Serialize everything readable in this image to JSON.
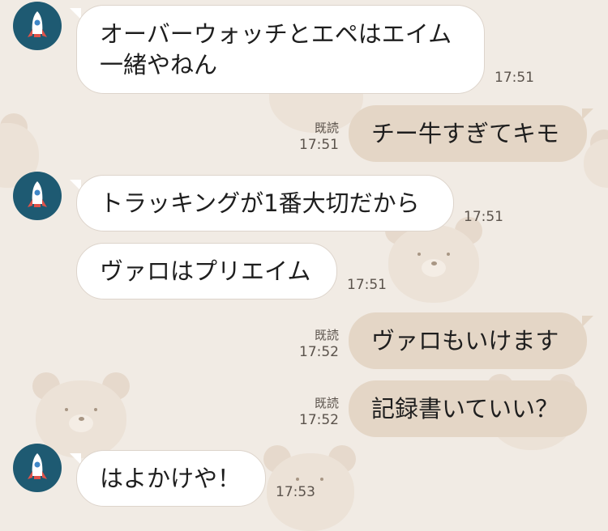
{
  "chat": {
    "messages": [
      {
        "direction": "in",
        "text": "オーバーウォッチとエペはエイム一緒やねん",
        "time": "17:51"
      },
      {
        "direction": "out",
        "text": "チー牛すぎてキモ",
        "time": "17:51",
        "status": "既読"
      },
      {
        "direction": "in",
        "text": "トラッキングが1番大切だから",
        "time": "17:51"
      },
      {
        "direction": "in",
        "text": "ヴァロはプリエイム",
        "time": "17:51"
      },
      {
        "direction": "out",
        "text": "ヴァロもいけます",
        "time": "17:52",
        "status": "既読"
      },
      {
        "direction": "out",
        "text": "記録書いていい？",
        "time": "17:52",
        "status": "既読"
      },
      {
        "direction": "in",
        "text": "はよかけや！",
        "time": "17:53"
      }
    ]
  },
  "colors": {
    "background": "#f1ebe4",
    "incoming_bubble": "#ffffff",
    "outgoing_bubble": "#e4d6c6",
    "avatar_bg": "#1e5a72"
  },
  "icons": {
    "avatar": "rocket-icon",
    "wallpaper": "bear-icon"
  }
}
